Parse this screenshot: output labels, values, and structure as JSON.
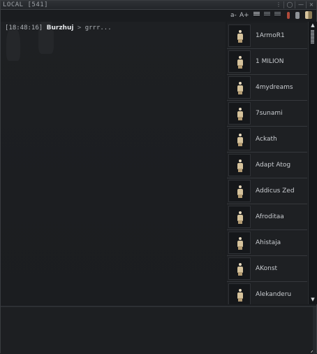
{
  "window": {
    "title": "LOCAL [541]"
  },
  "toolbar": {
    "font_smaller": "a-",
    "font_larger": "A+"
  },
  "chat": {
    "messages": [
      {
        "time": "[18:48:16]",
        "sender": "Burzhuj",
        "separator": ">",
        "text": "grrr..."
      }
    ]
  },
  "members": [
    {
      "name": "1ArmoR1"
    },
    {
      "name": "1 MILION"
    },
    {
      "name": "4mydreams"
    },
    {
      "name": "7sunami"
    },
    {
      "name": "Ackath"
    },
    {
      "name": "Adapt Atog"
    },
    {
      "name": "Addicus Zed"
    },
    {
      "name": "Afroditaa"
    },
    {
      "name": "Ahistaja"
    },
    {
      "name": "AKonst"
    },
    {
      "name": "Alekanderu"
    }
  ],
  "input": {
    "value": ""
  },
  "colors": {
    "window_bg": "#1a1c1f",
    "text": "#c9ccd0",
    "border": "#3a3d41",
    "portrait": "#d6c39c"
  },
  "icons": [
    "info-icon",
    "settings-icon",
    "minimize-icon",
    "close-icon",
    "channel-settings-icon",
    "members-icon",
    "scroll-up-icon",
    "scroll-down-icon"
  ]
}
